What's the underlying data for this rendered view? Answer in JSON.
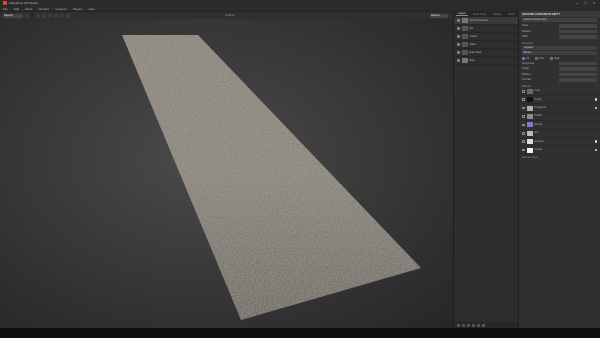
{
  "window": {
    "title": "Substance 3D Painter"
  },
  "menu": [
    "File",
    "Edit",
    "Mode",
    "Window",
    "Viewport",
    "Plugins",
    "Help"
  ],
  "toolbar": {
    "mode": "Material",
    "view_title": "Viewport",
    "view_mode": "Material"
  },
  "layers": {
    "tabs": [
      "Layers",
      "Texture Set",
      "Display",
      "Shelf"
    ],
    "items": [
      {
        "name": "Ground Concrete",
        "selected": true
      },
      {
        "name": "Dirt"
      },
      {
        "name": "Cracks"
      },
      {
        "name": "Stains"
      },
      {
        "name": "Edge Wear"
      },
      {
        "name": "Base"
      }
    ]
  },
  "properties": {
    "title": "GROUND CONCRETE DIRTY",
    "material_field": "Ground Concrete Dirty",
    "rows1": [
      "Scale",
      "Rotation",
      "Offset"
    ],
    "projection_label": "Projection",
    "projection": "Tri-planar",
    "filtering": "Bilinear",
    "radio_options": [
      "Fill",
      "Paint",
      "Mask"
    ],
    "rows2": [
      "Roughness",
      "Height",
      "Balance",
      "Contrast"
    ],
    "channels_label": "Material",
    "channels": [
      {
        "name": "Color",
        "color": "#6a6a6a",
        "dot": false
      },
      {
        "name": "Height",
        "color": "#111111",
        "dot": true
      },
      {
        "name": "Roughness",
        "color": "#b0b0b0",
        "dot": true
      },
      {
        "name": "Metallic",
        "color": "#8a8a8a",
        "dot": false
      },
      {
        "name": "Normal",
        "color": "#7a7ad8",
        "dot": false
      },
      {
        "name": "AO",
        "color": "#bbbbbb",
        "dot": false
      },
      {
        "name": "Emissive",
        "color": "#dddddd",
        "dot": true
      },
      {
        "name": "Opacity",
        "color": "#f2f2f2",
        "dot": true
      }
    ],
    "footer": "Material opacity"
  }
}
